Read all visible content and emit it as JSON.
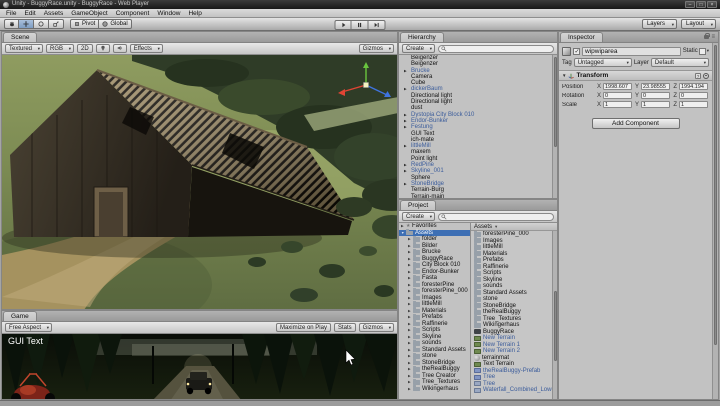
{
  "window": {
    "title": "Unity - BuggyRace.unity - BuggyRace - Web Player",
    "menus": [
      "File",
      "Edit",
      "Assets",
      "GameObject",
      "Component",
      "Window",
      "Help"
    ]
  },
  "toolbar": {
    "pivot_label": "Pivot",
    "global_label": "Global",
    "layers_label": "Layers",
    "layout_label": "Layout"
  },
  "scene": {
    "tab": "Scene",
    "draw_mode": "Textured",
    "render_mode": "RGB",
    "toggle_2d": "2D",
    "effects_label": "Effects",
    "gizmos_label": "Gizmos"
  },
  "game": {
    "tab": "Game",
    "aspect": "Free Aspect",
    "maximize_on_play_label": "Maximize on Play",
    "stats_label": "Stats",
    "gizmos_label": "Gizmos",
    "gui_text": "GUI Text"
  },
  "hierarchy": {
    "tab": "Hierarchy",
    "create_label": "Create",
    "items": [
      {
        "label": "Beigenzer"
      },
      {
        "label": "Beigenzer"
      },
      {
        "label": "Brucke",
        "prefab": true,
        "arrow": true
      },
      {
        "label": "Camera"
      },
      {
        "label": "Cube"
      },
      {
        "label": "dickerBaum",
        "prefab": true,
        "arrow": true
      },
      {
        "label": "Directional light"
      },
      {
        "label": "Directional light"
      },
      {
        "label": "dust"
      },
      {
        "label": "Dystopia City Block 010",
        "prefab": true,
        "arrow": true
      },
      {
        "label": "Endor-Bunker",
        "prefab": true,
        "arrow": true
      },
      {
        "label": "Festung",
        "prefab": true,
        "arrow": true
      },
      {
        "label": "GUI Text"
      },
      {
        "label": "ich-mate"
      },
      {
        "label": "littleMill",
        "prefab": true,
        "arrow": true
      },
      {
        "label": "maxem"
      },
      {
        "label": "Point light"
      },
      {
        "label": "RedPine",
        "prefab": true,
        "arrow": true
      },
      {
        "label": "Skyline_001",
        "prefab": true,
        "arrow": true
      },
      {
        "label": "Sphere"
      },
      {
        "label": "StoneBridge",
        "prefab": true,
        "arrow": true
      },
      {
        "label": "Terrain-Burg"
      },
      {
        "label": "Terrain-main"
      }
    ]
  },
  "project": {
    "tab": "Project",
    "create_label": "Create",
    "favorites_label": "Favorites",
    "assets_root_label": "Assets",
    "assets_header": "Assets",
    "folders": [
      "folder",
      "Bilder",
      "Brucke",
      "BuggyRace",
      "City Block 010",
      "Endor-Bunker",
      "Fasta",
      "foresterPine",
      "foresterPine_000",
      "Images",
      "littleMill",
      "Materials",
      "Prefabs",
      "Raffinerie",
      "Scripts",
      "Skyline",
      "sounds",
      "Standard Assets",
      "stone",
      "StoneBridge",
      "theRealBuggy",
      "Tree Creator",
      "Tree_Textures",
      "Wikingerhaus"
    ],
    "assets": [
      {
        "label": "foresterPine_000",
        "kind": "folder"
      },
      {
        "label": "Images",
        "kind": "folder"
      },
      {
        "label": "littleMill",
        "kind": "folder"
      },
      {
        "label": "Materials",
        "kind": "folder"
      },
      {
        "label": "Prefabs",
        "kind": "folder"
      },
      {
        "label": "Raffinerie",
        "kind": "folder"
      },
      {
        "label": "Scripts",
        "kind": "folder"
      },
      {
        "label": "Skyline",
        "kind": "folder"
      },
      {
        "label": "sounds",
        "kind": "folder"
      },
      {
        "label": "Standard Assets",
        "kind": "folder"
      },
      {
        "label": "stone",
        "kind": "folder"
      },
      {
        "label": "StoneBridge",
        "kind": "folder"
      },
      {
        "label": "theRealBuggy",
        "kind": "folder"
      },
      {
        "label": "Tree_Textures",
        "kind": "folder"
      },
      {
        "label": "Wikingerhaus",
        "kind": "folder"
      },
      {
        "label": "BuggyRace",
        "kind": "scene"
      },
      {
        "label": "New Terrain",
        "kind": "terrain",
        "blue": true
      },
      {
        "label": "New Terrain 1",
        "kind": "terrain",
        "blue": true
      },
      {
        "label": "New Terrain 2",
        "kind": "terrain",
        "blue": true
      },
      {
        "label": "terrainmat",
        "kind": "material"
      },
      {
        "label": "Text Terrain",
        "kind": "terrain"
      },
      {
        "label": "theRealBuggy-Prefab",
        "kind": "prefab",
        "blue": true
      },
      {
        "label": "Tree",
        "kind": "prefab",
        "blue": true
      },
      {
        "label": "Tree",
        "kind": "model",
        "blue": true
      },
      {
        "label": "Waterfall_Combined_Lower",
        "kind": "model",
        "blue": true
      }
    ]
  },
  "inspector": {
    "tab": "Inspector",
    "object_name": "wipwiparea",
    "static_label": "Static",
    "tag_label": "Tag",
    "tag_value": "Untagged",
    "layer_label": "Layer",
    "layer_value": "Default",
    "transform": {
      "title": "Transform",
      "axis_labels": {
        "x": "X",
        "y": "Y",
        "z": "Z"
      },
      "rows": [
        {
          "label": "Position",
          "x": "1998.607",
          "y": "23.98555",
          "z": "1994.194"
        },
        {
          "label": "Rotation",
          "x": "0",
          "y": "0",
          "z": "0"
        },
        {
          "label": "Scale",
          "x": "1",
          "y": "1",
          "z": "1"
        }
      ]
    },
    "add_component_label": "Add Component"
  },
  "colors": {
    "selection_blue": "#3d6fb4",
    "prefab_text": "#3b5c9b",
    "gizmo_red": "#e04434",
    "gizmo_green": "#69c53e",
    "gizmo_blue": "#3f74e0"
  }
}
